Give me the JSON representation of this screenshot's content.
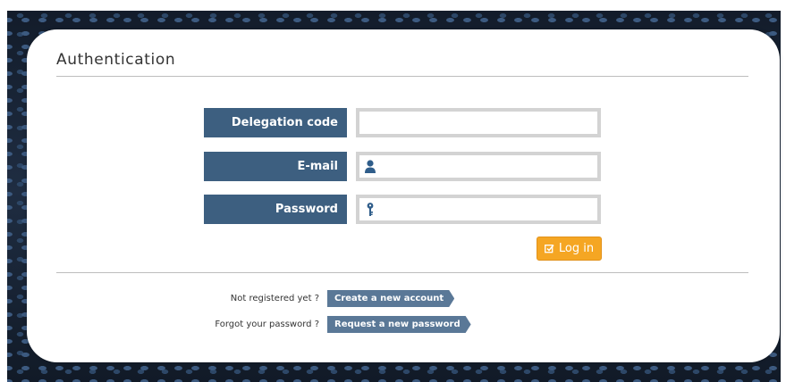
{
  "title": "Authentication",
  "form": {
    "delegation_label": "Delegation code",
    "delegation_value": "",
    "email_label": "E-mail",
    "email_value": "",
    "password_label": "Password",
    "password_value": ""
  },
  "login": {
    "label": "Log in",
    "icon": "checkbox-edit-icon"
  },
  "links": {
    "register_text": "Not registered yet ?",
    "register_button": "Create a new account",
    "forgot_text": "Forgot your password ?",
    "forgot_button": "Request a new password"
  },
  "icons": {
    "email": "user-icon",
    "password": "key-icon"
  },
  "colors": {
    "label_bg": "#3d5f80",
    "link_button_bg": "#5a7897",
    "login_bg": "#f5a623",
    "input_border": "#d3d3d3",
    "page_bg": "#1a2536"
  }
}
